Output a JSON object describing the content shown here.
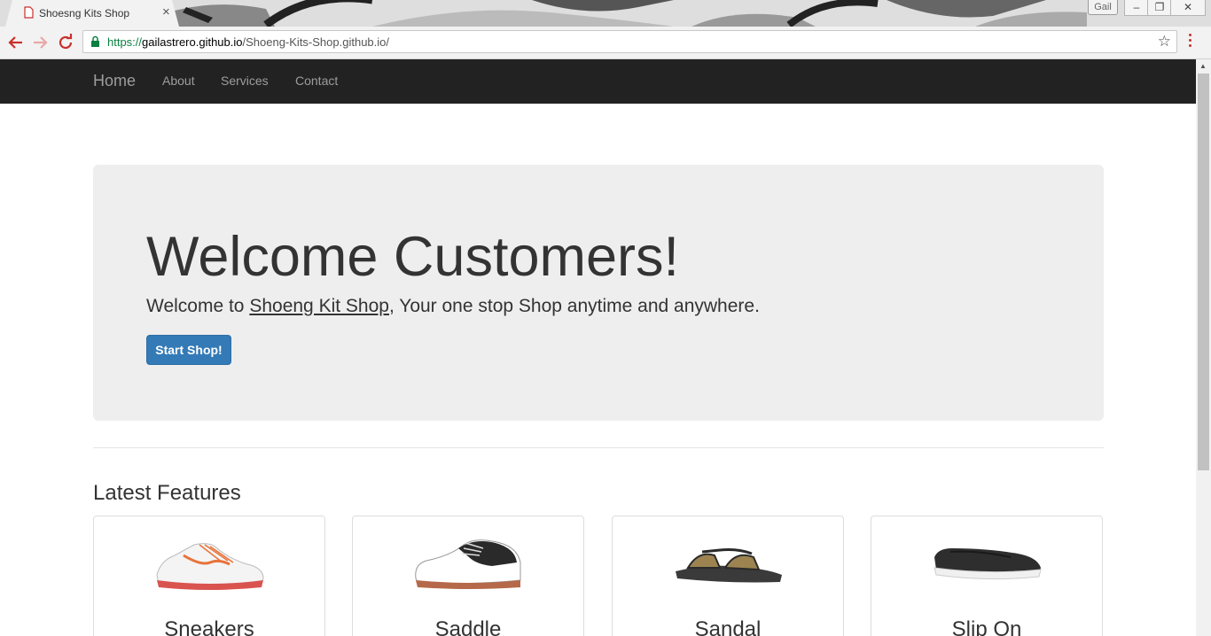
{
  "browser": {
    "tab_title": "Shoesng Kits Shop",
    "tab_close": "×",
    "user_badge": "Gail",
    "url_scheme": "https://",
    "url_host": "gailastrero.github.io",
    "url_path": "/Shoeng-Kits-Shop.github.io/",
    "bookmark_icon": "☆",
    "window_buttons": [
      "–",
      "❐",
      "✕"
    ]
  },
  "navbar": {
    "brand": "Home",
    "links": [
      "About",
      "Services",
      "Contact"
    ]
  },
  "jumbotron": {
    "title": "Welcome Customers!",
    "text_before": "Welcome to ",
    "shop_link": "Shoeng Kit Shop",
    "text_after": ", Your one stop Shop anytime and anywhere.",
    "button": "Start Shop!"
  },
  "features": {
    "title": "Latest Features",
    "items": [
      {
        "name": "Sneakers",
        "icon": "sneaker-icon"
      },
      {
        "name": "Saddle",
        "icon": "saddle-shoe-icon"
      },
      {
        "name": "Sandal",
        "icon": "sandal-icon"
      },
      {
        "name": "Slip On",
        "icon": "slip-on-icon"
      }
    ]
  },
  "colors": {
    "navbar_bg": "#222222",
    "primary_button": "#337ab7",
    "jumbotron_bg": "#eeeeee"
  }
}
